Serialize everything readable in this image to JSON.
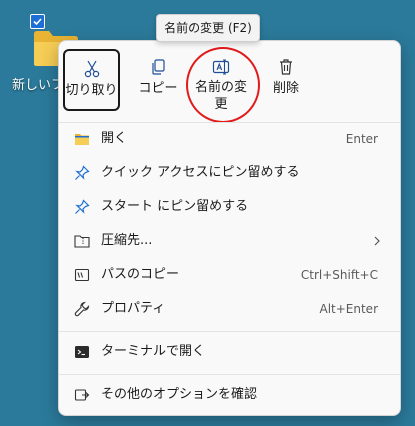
{
  "desktop": {
    "folder_label": "新しいフォ"
  },
  "tooltip": "名前の変更 (F2)",
  "toolbar": {
    "cut": "切り取り",
    "copy": "コピー",
    "rename_line1": "名前の変",
    "rename_line2": "更",
    "delete": "削除"
  },
  "menu": {
    "open": "開く",
    "open_shortcut": "Enter",
    "pin_quick": "クイック アクセスにピン留めする",
    "pin_start": "スタート にピン留めする",
    "compress": "圧縮先...",
    "copy_path": "パスのコピー",
    "copy_path_shortcut": "Ctrl+Shift+C",
    "properties": "プロパティ",
    "properties_shortcut": "Alt+Enter",
    "terminal": "ターミナルで開く",
    "more_options": "その他のオプションを確認"
  },
  "colors": {
    "accent": "#1d6fd6",
    "highlight_circle": "#e11a1a",
    "desktop_bg": "#2b7a9b"
  }
}
